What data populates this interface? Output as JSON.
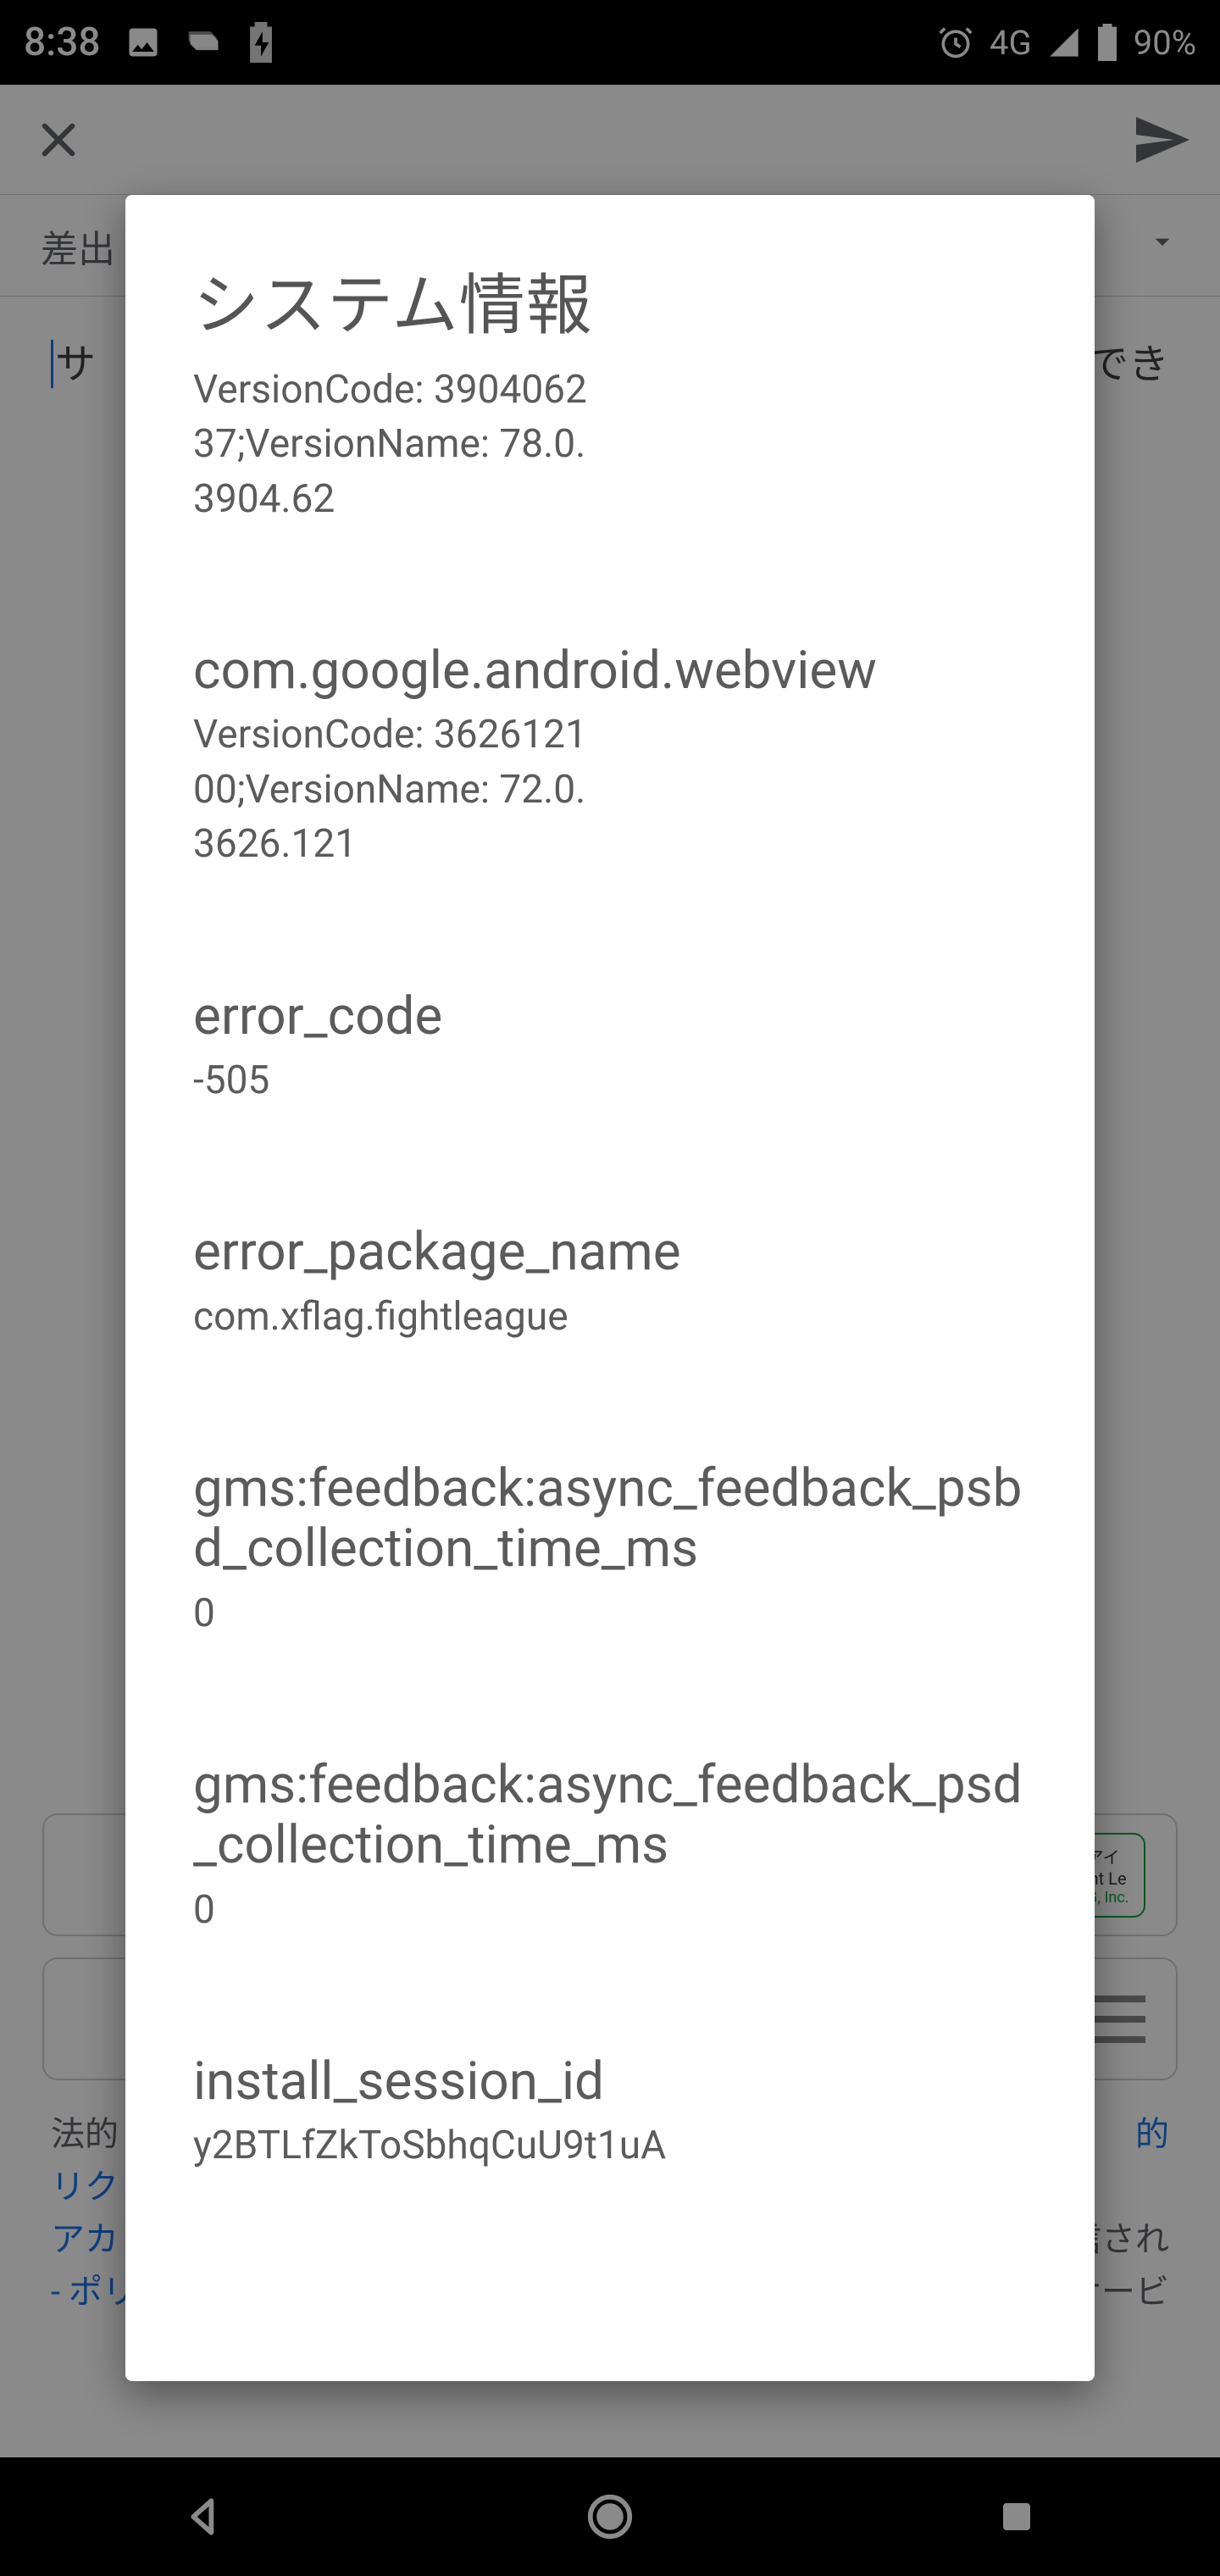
{
  "statusbar": {
    "clock": "8:38",
    "network": "4G",
    "battery": "90%"
  },
  "background": {
    "from_label": "差出",
    "body_fragment_prefix": "サ",
    "body_fragment_suffix": "有でき",
    "app_tile": {
      "line1": "アイ",
      "line2": "ght Le",
      "line3": "AG, Inc."
    },
    "legal_plain1": "法的",
    "legal_link1": "的",
    "legal_link2": "リク",
    "legal_link3": "アカ",
    "legal_plain2": "信され",
    "legal_link4": "- ポリシ",
    "legal_plain3": "やサービ"
  },
  "dialog": {
    "title": "システム情報",
    "entries": [
      {
        "k": "",
        "v": "VersionCode: 390406237;VersionName: 78.0.3904.62"
      },
      {
        "k": "com.google.android.webview",
        "v": "VersionCode: 362612100;VersionName: 72.0.3626.121"
      },
      {
        "k": "error_code",
        "v": "-505"
      },
      {
        "k": "error_package_name",
        "v": "com.xflag.fightleague"
      },
      {
        "k": "gms:feedback:async_feedback_psbd_collection_time_ms",
        "v": "0"
      },
      {
        "k": "gms:feedback:async_feedback_psd_collection_time_ms",
        "v": "0"
      },
      {
        "k": "install_session_id",
        "v": "y2BTLfZkToSbhqCuU9t1uA"
      }
    ]
  }
}
